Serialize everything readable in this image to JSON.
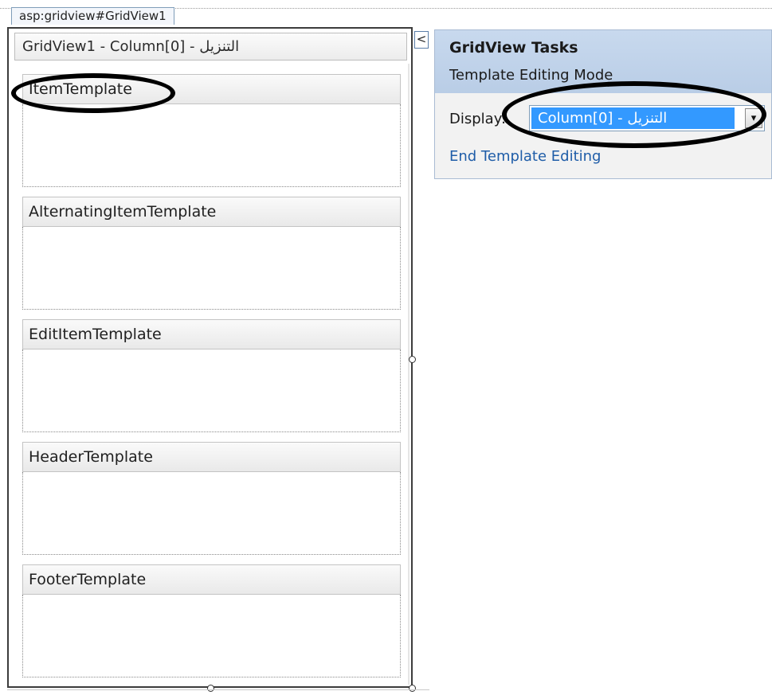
{
  "tag_label": "asp:gridview#GridView1",
  "grid_title": "GridView1 - Column[0] - التنزيل",
  "templates": [
    {
      "name": "ItemTemplate"
    },
    {
      "name": "AlternatingItemTemplate"
    },
    {
      "name": "EditItemTemplate"
    },
    {
      "name": "HeaderTemplate"
    },
    {
      "name": "FooterTemplate"
    }
  ],
  "smart_tag": {
    "expand_glyph": "<",
    "icon": "chevron-left-icon"
  },
  "tasks": {
    "title": "GridView Tasks",
    "subtitle": "Template Editing Mode",
    "display_label": "Display:",
    "display_value": "Column[0] - التنزيل",
    "dropdown_glyph": "▾",
    "end_link": "End Template Editing"
  },
  "colors": {
    "panel_header": "#c8d9ee",
    "selection": "#3399ff",
    "link": "#1f5da8",
    "annotation": "#000000"
  }
}
